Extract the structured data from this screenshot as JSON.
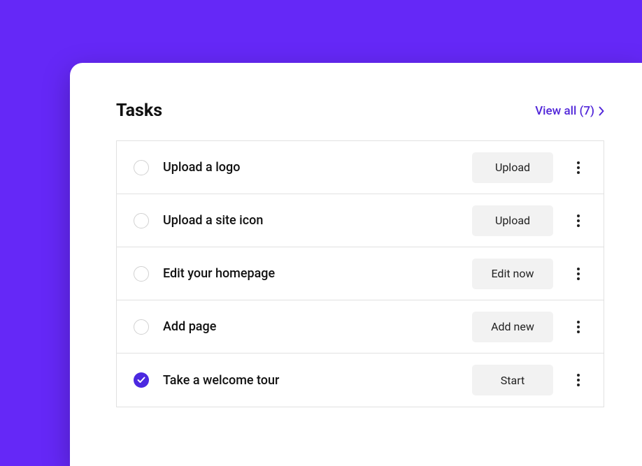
{
  "header": {
    "title": "Tasks",
    "view_all_label": "View all (7)"
  },
  "tasks": [
    {
      "label": "Upload a logo",
      "action": "Upload",
      "completed": false
    },
    {
      "label": "Upload a site icon",
      "action": "Upload",
      "completed": false
    },
    {
      "label": "Edit your homepage",
      "action": "Edit now",
      "completed": false
    },
    {
      "label": "Add page",
      "action": "Add new",
      "completed": false
    },
    {
      "label": "Take a welcome tour",
      "action": "Start",
      "completed": true
    }
  ],
  "colors": {
    "accent": "#6528F7",
    "link": "#5126D9",
    "complete": "#4B28E0"
  }
}
